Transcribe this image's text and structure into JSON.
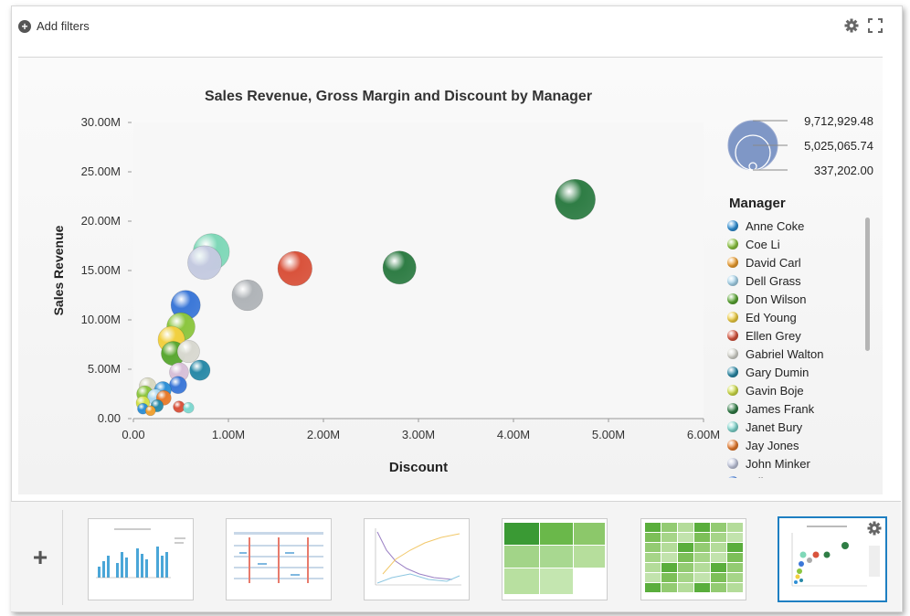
{
  "toolbar": {
    "add_filters_label": "Add filters",
    "add_icon": "plus-circle-icon",
    "settings_icon": "gear-icon",
    "expand_icon": "expand-icon"
  },
  "chart_data": {
    "type": "bubble",
    "title": "Sales Revenue, Gross Margin and Discount by Manager",
    "xlabel": "Discount",
    "ylabel": "Sales Revenue",
    "xlim": [
      0,
      6000000
    ],
    "ylim": [
      0,
      30000000
    ],
    "x_ticks": [
      "0.00",
      "1.00M",
      "2.00M",
      "3.00M",
      "4.00M",
      "5.00M",
      "6.00M"
    ],
    "y_ticks": [
      "0.00",
      "5.00M",
      "10.00M",
      "15.00M",
      "20.00M",
      "25.00M",
      "30.00M"
    ],
    "size_measure": "Gross Margin",
    "size_legend": [
      "9,712,929.48",
      "5,025,065.74",
      "337,202.00"
    ],
    "legend_title": "Manager",
    "legend": [
      {
        "name": "Anne Coke",
        "color": "#2e8fd6"
      },
      {
        "name": "Coe Li",
        "color": "#8cc63f"
      },
      {
        "name": "David Carl",
        "color": "#f0a030"
      },
      {
        "name": "Dell Grass",
        "color": "#a9d8f0"
      },
      {
        "name": "Don Wilson",
        "color": "#5aa832"
      },
      {
        "name": "Ed Young",
        "color": "#f2d040"
      },
      {
        "name": "Ellen Grey",
        "color": "#d9533c"
      },
      {
        "name": "Gabriel Walton",
        "color": "#d8d8d0"
      },
      {
        "name": "Gary Dumin",
        "color": "#2a8aa8"
      },
      {
        "name": "Gavin Boje",
        "color": "#d2e048"
      },
      {
        "name": "James Frank",
        "color": "#2f7d45"
      },
      {
        "name": "Janet Bury",
        "color": "#7fd8d0"
      },
      {
        "name": "Jay Jones",
        "color": "#e87b2c"
      },
      {
        "name": "John Minker",
        "color": "#c4cae0"
      },
      {
        "name": "Julie L",
        "color": "#3c78d8"
      }
    ],
    "points": [
      {
        "x": 4650000,
        "y": 22200000,
        "size": 9712929,
        "color": "#2f7d45"
      },
      {
        "x": 2800000,
        "y": 15300000,
        "size": 6600000,
        "color": "#2f7d45"
      },
      {
        "x": 1700000,
        "y": 15200000,
        "size": 7100000,
        "color": "#d9533c"
      },
      {
        "x": 1200000,
        "y": 12500000,
        "size": 5700000,
        "color": "#b0b4b8"
      },
      {
        "x": 820000,
        "y": 16900000,
        "size": 7900000,
        "color": "#7fd8b8"
      },
      {
        "x": 750000,
        "y": 15800000,
        "size": 6900000,
        "color": "#c4cae0"
      },
      {
        "x": 550000,
        "y": 11500000,
        "size": 5200000,
        "color": "#3c78d8"
      },
      {
        "x": 500000,
        "y": 9300000,
        "size": 4800000,
        "color": "#8cc63f"
      },
      {
        "x": 400000,
        "y": 8000000,
        "size": 4300000,
        "color": "#f2d040"
      },
      {
        "x": 580000,
        "y": 6800000,
        "size": 3000000,
        "color": "#d8d8d0"
      },
      {
        "x": 420000,
        "y": 6600000,
        "size": 3500000,
        "color": "#5aa832"
      },
      {
        "x": 700000,
        "y": 4900000,
        "size": 2500000,
        "color": "#2a8aa8"
      },
      {
        "x": 480000,
        "y": 4700000,
        "size": 2200000,
        "color": "#d8c0d8"
      },
      {
        "x": 470000,
        "y": 3400000,
        "size": 1800000,
        "color": "#3c78d8"
      },
      {
        "x": 150000,
        "y": 3300000,
        "size": 1700000,
        "color": "#d8d8c0"
      },
      {
        "x": 310000,
        "y": 2900000,
        "size": 1700000,
        "color": "#2e8fd6"
      },
      {
        "x": 120000,
        "y": 2500000,
        "size": 1600000,
        "color": "#8cc63f"
      },
      {
        "x": 230000,
        "y": 2200000,
        "size": 1500000,
        "color": "#a9d8f0"
      },
      {
        "x": 320000,
        "y": 2100000,
        "size": 1300000,
        "color": "#e87b2c"
      },
      {
        "x": 100000,
        "y": 1600000,
        "size": 1100000,
        "color": "#d2e048"
      },
      {
        "x": 250000,
        "y": 1300000,
        "size": 900000,
        "color": "#2a8aa8"
      },
      {
        "x": 480000,
        "y": 1200000,
        "size": 800000,
        "color": "#d9533c"
      },
      {
        "x": 580000,
        "y": 1100000,
        "size": 700000,
        "color": "#7fd8d0"
      },
      {
        "x": 100000,
        "y": 1000000,
        "size": 700000,
        "color": "#2e8fd6"
      },
      {
        "x": 180000,
        "y": 800000,
        "size": 600000,
        "color": "#f0a030"
      }
    ]
  },
  "thumbnails": [
    {
      "name": "column-chart-thumbnail",
      "active": false
    },
    {
      "name": "pivot-table-thumbnail",
      "active": false
    },
    {
      "name": "line-chart-thumbnail",
      "active": false
    },
    {
      "name": "treemap-thumbnail",
      "active": false
    },
    {
      "name": "heatmap-thumbnail",
      "active": false
    },
    {
      "name": "bubble-chart-thumbnail",
      "active": true
    }
  ],
  "add_visualization_icon": "plus-icon"
}
